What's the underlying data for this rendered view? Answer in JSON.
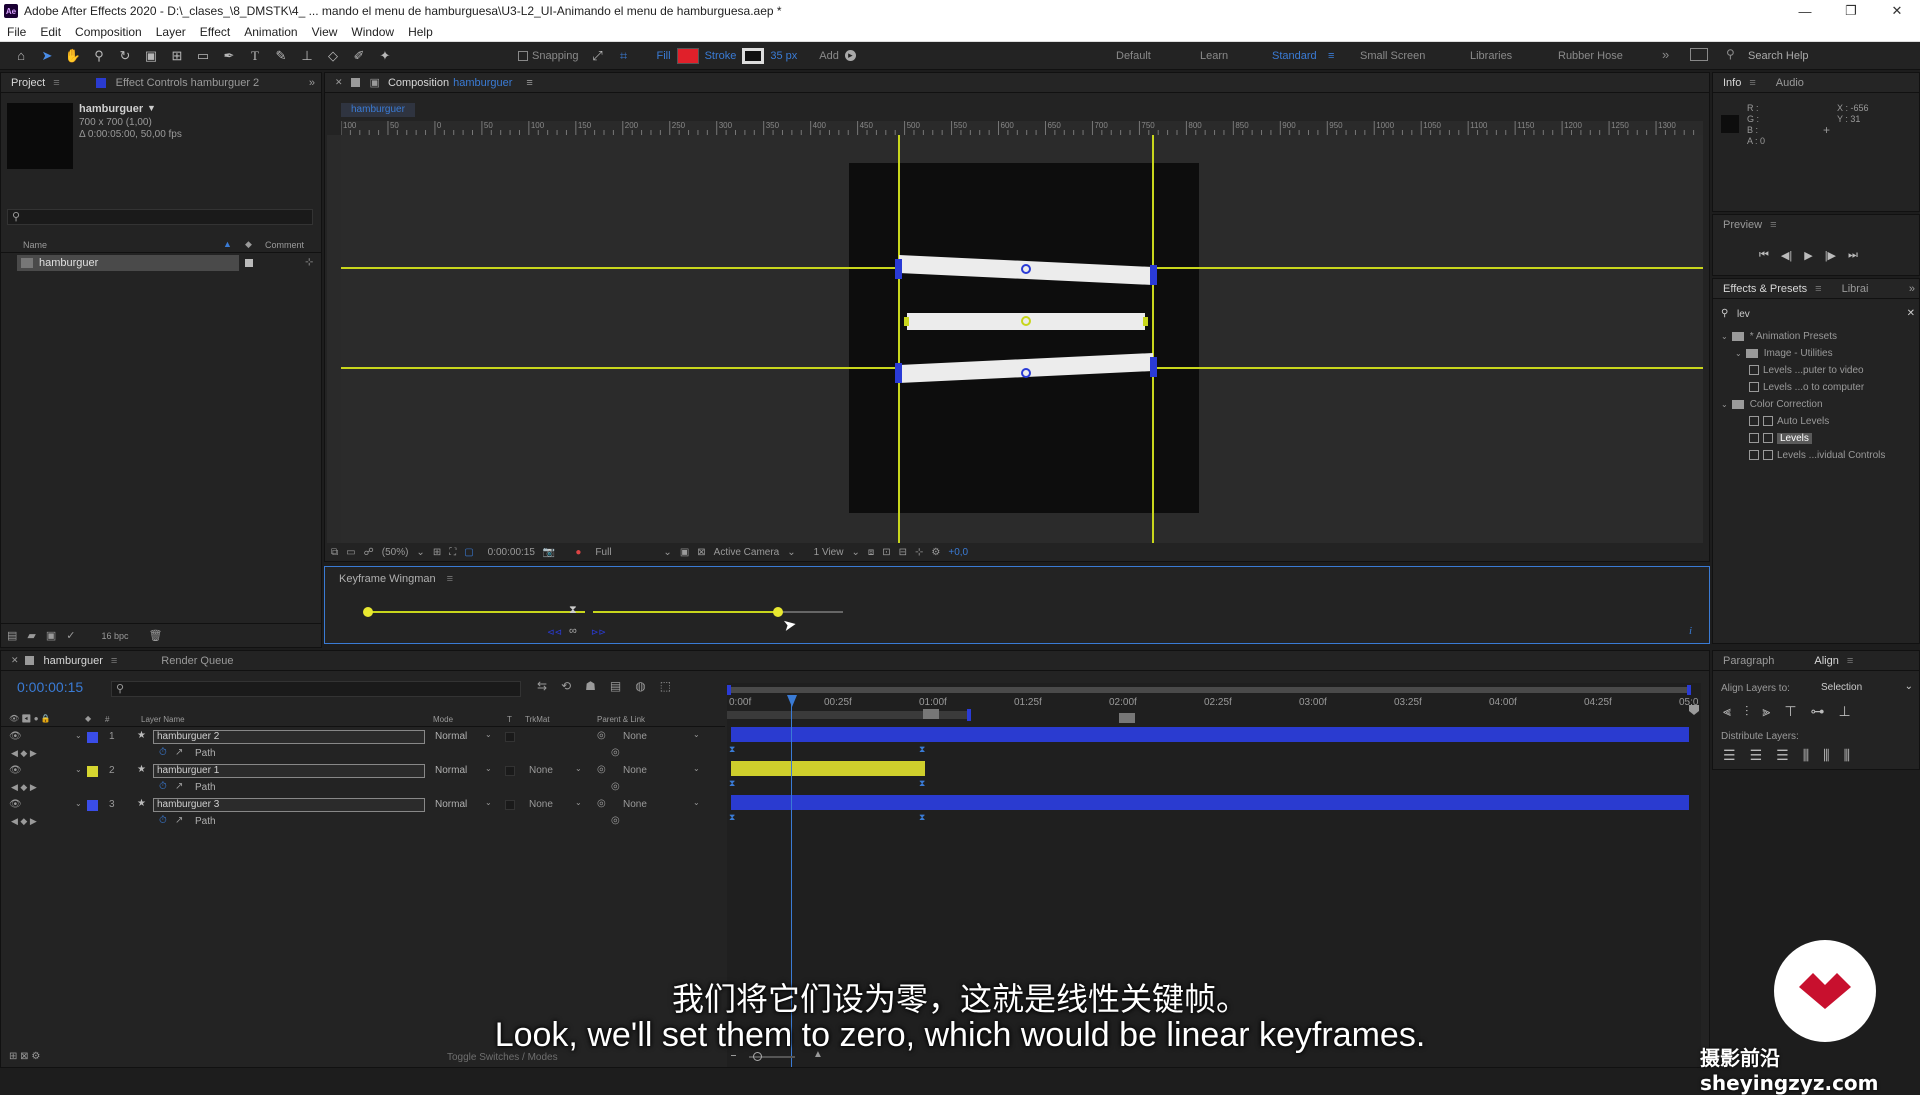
{
  "app": {
    "title": "Adobe After Effects 2020 - D:\\_clases_\\8_DMSTK\\4_ ... mando el menu de hamburguesa\\U3-L2_UI-Animando el menu de hamburguesa.aep *",
    "icon_label": "Ae"
  },
  "menu": [
    "File",
    "Edit",
    "Composition",
    "Layer",
    "Effect",
    "Animation",
    "View",
    "Window",
    "Help"
  ],
  "toolbar": {
    "snapping": "Snapping",
    "fill": "Fill",
    "stroke": "Stroke",
    "stroke_width": "35 px",
    "add": "Add",
    "fill_color": "#e0202a"
  },
  "workspaces": [
    "Default",
    "Learn",
    "Standard",
    "Small Screen",
    "Libraries",
    "Rubber Hose"
  ],
  "active_workspace": "Standard",
  "search_help": "Search Help",
  "project": {
    "tab": "Project",
    "effect_controls_tab": "Effect Controls hamburguer 2",
    "item_name": "hamburguer",
    "item_size": "700 x 700 (1,00)",
    "item_duration": "Δ 0:00:05:00, 50,00 fps",
    "col_name": "Name",
    "col_comment": "Comment",
    "list_item": "hamburguer",
    "bpc": "16 bpc"
  },
  "composition": {
    "tab_prefix": "Composition",
    "tab_name": "hamburguer",
    "breadcrumb": "hamburguer",
    "ruler_labels": [
      "100",
      "50",
      "0",
      "50",
      "100",
      "150",
      "200",
      "250",
      "300",
      "350",
      "400",
      "450",
      "500",
      "550",
      "600",
      "650",
      "700",
      "750",
      "800",
      "850",
      "900",
      "950",
      "1000",
      "1050",
      "1100",
      "1150",
      "1200",
      "1250",
      "1300"
    ],
    "zoom": "(50%)",
    "timecode": "0:00:00:15",
    "resolution": "Full",
    "camera": "Active Camera",
    "views": "1 View",
    "exposure": "+0,0"
  },
  "wingman": {
    "title": "Keyframe Wingman"
  },
  "info": {
    "tab": "Info",
    "audio_tab": "Audio",
    "r": "R :",
    "g": "G :",
    "b": "B :",
    "a": "A : 0",
    "x": "X : -656",
    "y": "Y : 31"
  },
  "preview": {
    "tab": "Preview"
  },
  "effects": {
    "tab": "Effects & Presets",
    "libraries_tab": "Librai",
    "search": "lev",
    "items": [
      {
        "label": "* Animation Presets",
        "indent": 0,
        "type": "folder"
      },
      {
        "label": "Image - Utilities",
        "indent": 1,
        "type": "folder"
      },
      {
        "label": "Levels ...puter to video",
        "indent": 2,
        "type": "fx"
      },
      {
        "label": "Levels ...o to computer",
        "indent": 2,
        "type": "fx"
      },
      {
        "label": "Color Correction",
        "indent": 0,
        "type": "folder"
      },
      {
        "label": "Auto Levels",
        "indent": 2,
        "type": "fx"
      },
      {
        "label": "Levels",
        "indent": 2,
        "type": "fx",
        "selected": true
      },
      {
        "label": "Levels ...ividual Controls",
        "indent": 2,
        "type": "fx"
      }
    ]
  },
  "timeline": {
    "tab": "hamburguer",
    "render_queue_tab": "Render Queue",
    "timecode": "0:00:00:15",
    "col_layer_name": "Layer Name",
    "col_mode": "Mode",
    "col_t": "T",
    "col_trkmat": "TrkMat",
    "col_parent": "Parent & Link",
    "ruler": [
      "0:00f",
      "00:25f",
      "01:00f",
      "01:25f",
      "02:00f",
      "02:25f",
      "03:00f",
      "03:25f",
      "04:00f",
      "04:25f",
      "05:0"
    ],
    "layers": [
      {
        "num": "1",
        "name": "hamburguer 2",
        "mode": "Normal",
        "trkmat": "",
        "parent": "None",
        "label_color": "#3a4de8",
        "bar_color": "#2a3bd0",
        "prop": "Path"
      },
      {
        "num": "2",
        "name": "hamburguer 1",
        "mode": "Normal",
        "trkmat": "None",
        "parent": "None",
        "label_color": "#d6d630",
        "bar_color": "#cfcf2c",
        "prop": "Path"
      },
      {
        "num": "3",
        "name": "hamburguer 3",
        "mode": "Normal",
        "trkmat": "None",
        "parent": "None",
        "label_color": "#3a4de8",
        "bar_color": "#2a3bd0",
        "prop": "Path"
      }
    ],
    "toggle": "Toggle Switches / Modes"
  },
  "paragraph": {
    "tab": "Paragraph",
    "align_tab": "Align",
    "align_to_label": "Align Layers to:",
    "align_to_value": "Selection",
    "distribute_label": "Distribute Layers:"
  },
  "subtitle": {
    "zh": "我们将它们设为零，这就是线性关键帧。",
    "en": "Look, we'll set them to zero, which would be linear keyframes."
  },
  "watermark": "摄影前沿 sheyingzyz.com"
}
